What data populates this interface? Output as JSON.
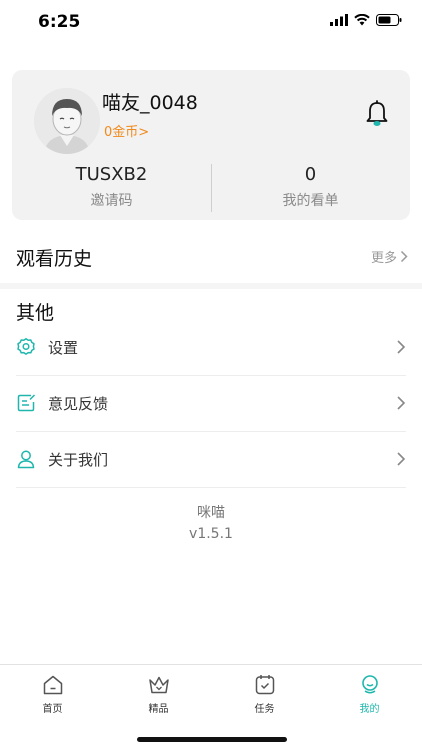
{
  "status": {
    "time": "6:25"
  },
  "profile": {
    "username": "喵友_0048",
    "coins_label": "0金币>",
    "invite_code": "TUSXB2",
    "invite_label": "邀请码",
    "watchlist_count": "0",
    "watchlist_label": "我的看单"
  },
  "history": {
    "title": "观看历史",
    "more_label": "更多"
  },
  "other": {
    "title": "其他",
    "items": [
      {
        "label": "设置",
        "icon": "gear-icon"
      },
      {
        "label": "意见反馈",
        "icon": "feedback-icon"
      },
      {
        "label": "关于我们",
        "icon": "person-icon"
      }
    ]
  },
  "app": {
    "name": "咪喵",
    "version": "v1.5.1"
  },
  "tabs": [
    {
      "label": "首页",
      "icon": "home-icon",
      "active": false
    },
    {
      "label": "精品",
      "icon": "crown-icon",
      "active": false
    },
    {
      "label": "任务",
      "icon": "task-icon",
      "active": false
    },
    {
      "label": "我的",
      "icon": "profile-icon",
      "active": true
    }
  ],
  "colors": {
    "accent": "#1fb7ad",
    "coins": "#f08a1d",
    "card_bg": "#f2f2f2"
  }
}
